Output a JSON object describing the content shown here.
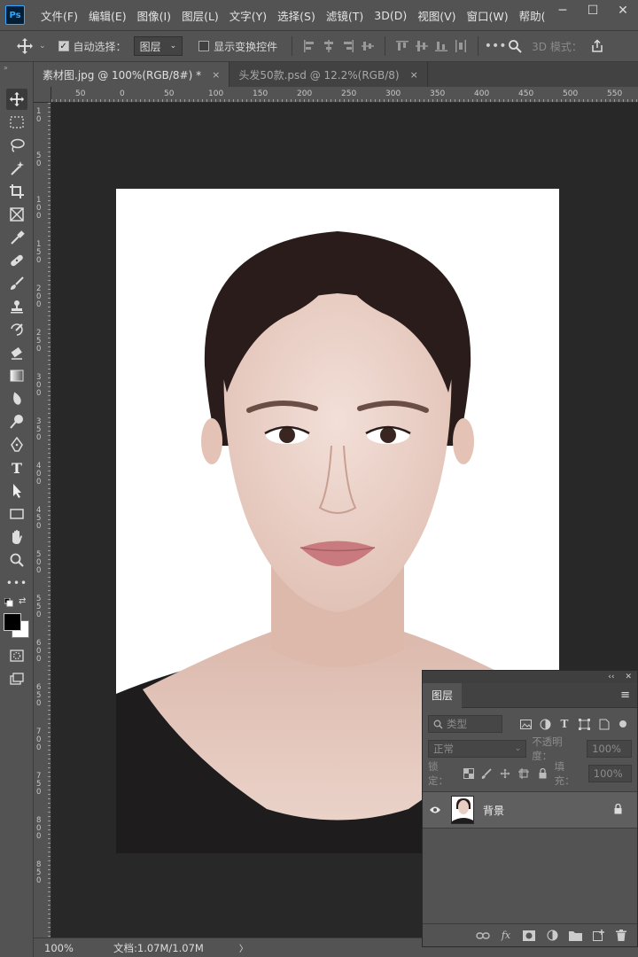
{
  "app": {
    "logo_text": "Ps"
  },
  "menu": [
    "文件(F)",
    "编辑(E)",
    "图像(I)",
    "图层(L)",
    "文字(Y)",
    "选择(S)",
    "滤镜(T)",
    "3D(D)",
    "视图(V)",
    "窗口(W)",
    "帮助("
  ],
  "window": {
    "minimize": "─",
    "restore": "☐",
    "close": "✕"
  },
  "options": {
    "auto_select_label": "自动选择：",
    "auto_select_target": "图层",
    "show_transform_label": "显示变换控件",
    "mode_3d_label": "3D 模式："
  },
  "tabs": [
    {
      "label": "素材图.jpg @ 100%(RGB/8#) *",
      "close": "×"
    },
    {
      "label": "头发50款.psd @ 12.2%(RGB/8)",
      "close": "×"
    }
  ],
  "ruler": {
    "h_labels": [
      "50",
      "0",
      "50",
      "100",
      "150",
      "200",
      "250",
      "300",
      "350",
      "400",
      "450",
      "500",
      "550"
    ],
    "v_labels": [
      "1\n0",
      "5\n0",
      "1\n0\n0",
      "1\n5\n0",
      "2\n0\n0",
      "2\n5\n0",
      "3\n0\n0",
      "3\n5\n0",
      "4\n0\n0",
      "4\n5\n0",
      "5\n0\n0",
      "5\n5\n0",
      "6\n0\n0",
      "6\n5\n0",
      "7\n0\n0",
      "7\n5\n0",
      "8\n0\n0",
      "8\n5\n0"
    ]
  },
  "status": {
    "zoom": "100%",
    "doc_info": "文档:1.07M/1.07M",
    "arrow": "〉"
  },
  "layers_panel": {
    "collapse": "‹‹",
    "close": "✕",
    "tab_label": "图层",
    "menu_icon": "≡",
    "filter_placeholder": "类型",
    "blend_mode": "正常",
    "opacity_label": "不透明度：",
    "opacity_value": "100%",
    "lock_label": "锁定：",
    "fill_label": "填充：",
    "fill_value": "100%",
    "layers": [
      {
        "name": "背景",
        "visible": true,
        "locked": true
      }
    ]
  }
}
